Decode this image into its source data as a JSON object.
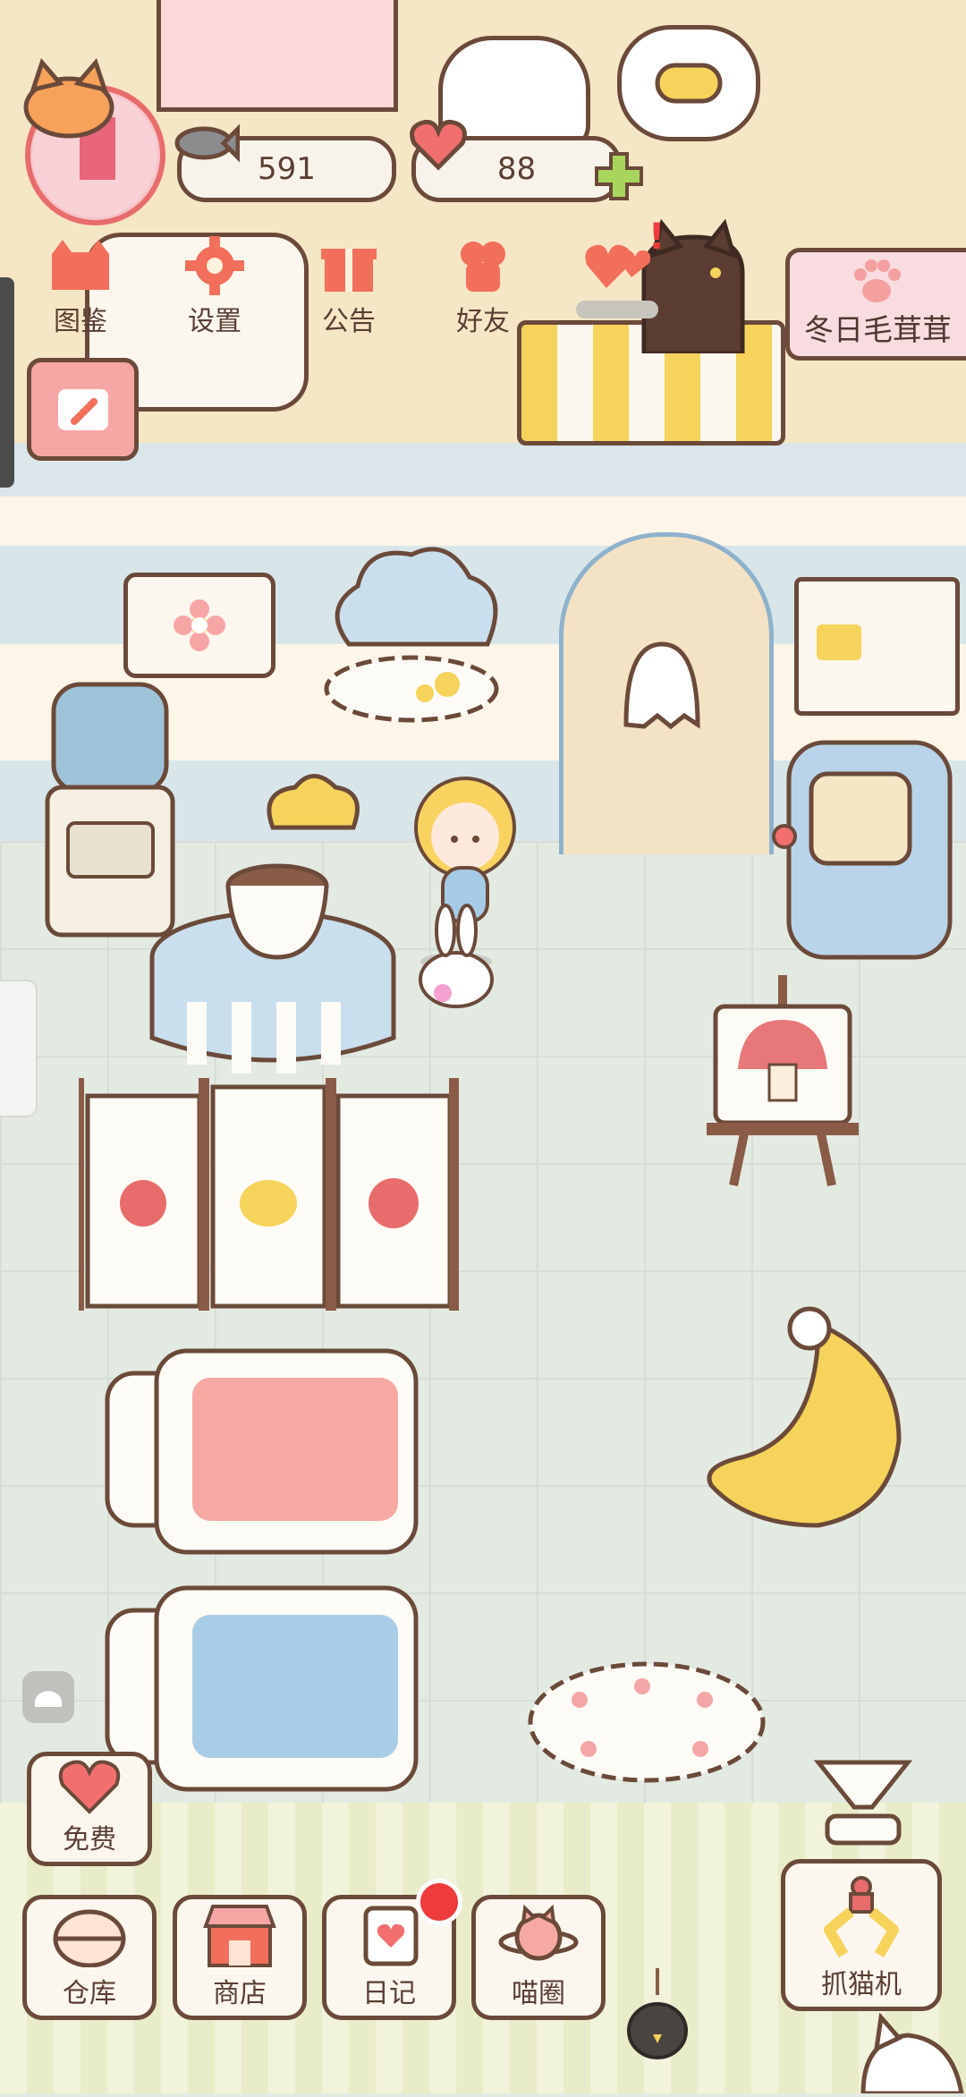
{
  "hud": {
    "coins_value": "591",
    "hearts_value": "88"
  },
  "menu": {
    "items": [
      {
        "label": "图鉴",
        "icon": "cat-book-icon"
      },
      {
        "label": "设置",
        "icon": "gear-icon"
      },
      {
        "label": "公告",
        "icon": "gift-icon"
      },
      {
        "label": "好友",
        "icon": "friends-icon"
      },
      {
        "label": "",
        "icon": "hearts-icon"
      }
    ]
  },
  "event": {
    "label": "冬日毛茸茸"
  },
  "free": {
    "label": "免费"
  },
  "bottom_nav": {
    "items": [
      {
        "label": "仓库",
        "icon": "storage-icon"
      },
      {
        "label": "商店",
        "icon": "shop-icon"
      },
      {
        "label": "日记",
        "icon": "diary-icon"
      },
      {
        "label": "喵圈",
        "icon": "planet-cat-icon"
      }
    ],
    "claw_label": "抓猫机"
  },
  "colors": {
    "accent": "#f26f5b",
    "outline": "#6b4a3a",
    "badge": "#ee3b3b"
  }
}
